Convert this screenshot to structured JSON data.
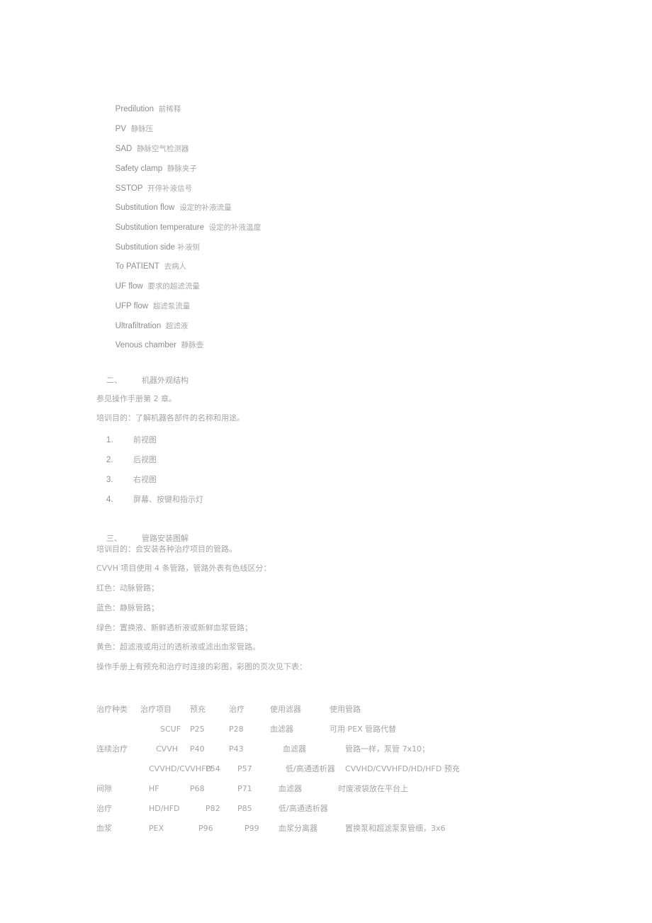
{
  "document": {
    "language": "zh-CN + en",
    "text_color": "#a0a0a0",
    "background": "#ffffff"
  },
  "glossary": {
    "items": [
      {
        "term": "Predilution",
        "gloss": "前稀释"
      },
      {
        "term": "PV",
        "gloss": "静脉压"
      },
      {
        "term": "SAD",
        "gloss": "静脉空气检测器"
      },
      {
        "term": "Safety clamp",
        "gloss": "静脉夹子"
      },
      {
        "term": "SSTOP",
        "gloss": "开停补液信号"
      },
      {
        "term": "Substitution flow",
        "gloss": "设定的补液流量"
      },
      {
        "term": "Substitution temperature",
        "gloss": "设定的补液温度"
      },
      {
        "term": "Substitution side",
        "gloss": "补液侧"
      },
      {
        "term": "To PATIENT",
        "gloss": "去病人"
      },
      {
        "term": "UF flow",
        "gloss": "要求的超滤流量"
      },
      {
        "term": "UFP flow",
        "gloss": "超滤泵流量"
      },
      {
        "term": "Ultrafiltration",
        "gloss": "超滤液"
      },
      {
        "term": "Venous chamber",
        "gloss": "静脉壶"
      }
    ]
  },
  "section_two": {
    "number": "二、",
    "title": "机器外观结构",
    "reference": "参见操作手册第 2 章。",
    "objective": "培训目的：了解机器各部件的名称和用途。",
    "items": [
      {
        "index": "1.",
        "label": "前视图"
      },
      {
        "index": "2.",
        "label": "后视图"
      },
      {
        "index": "3.",
        "label": "右视图"
      },
      {
        "index": "4.",
        "label": "屏幕、按键和指示灯"
      }
    ]
  },
  "section_three": {
    "number": "三、",
    "title": "管路安装图解",
    "objective": "培训目的：会安装各种治疗项目的管路。",
    "intro": "CVVH 项目使用 4 条管路，管路外表有色线区分：",
    "color_codes": [
      "红色：动脉管路；",
      "蓝色：静脉管路；",
      "绿色：置换液、新鲜透析液或新鲜血浆管路；",
      "黄色：超滤液或用过的透析液或滤出血浆管路。"
    ],
    "table_intro": "操作手册上有预充和治疗时连接的彩图，彩图的页次见下表："
  },
  "table": {
    "headers": [
      "治疗种类",
      "治疗项目",
      "预充",
      "治疗",
      "使用滤器",
      "使用管路"
    ],
    "rows": [
      {
        "indent": "ind-1",
        "cells": [
          "",
          "SCUF",
          "P25",
          "P28",
          "血滤器",
          "可用 PEX 管路代替"
        ]
      },
      {
        "indent": "",
        "cells": [
          "连续治疗",
          "CVVH",
          "P40",
          "P43",
          "血滤器",
          "管路一样，泵管 7x10；"
        ]
      },
      {
        "indent": "ind-2",
        "cells": [
          "",
          "CVVHD/CVVHFD",
          "P54",
          "P57",
          "低/高通透析器",
          "CVVHD/CVVHFD/HD/HFD 预充"
        ]
      },
      {
        "indent": "",
        "cells": [
          "间隙",
          "HF",
          "P68",
          "P71",
          "血滤器",
          "时废液袋放在平台上"
        ]
      },
      {
        "indent": "",
        "cells": [
          "治疗",
          "HD/HFD",
          "P82",
          "P85",
          "低/高通透析器",
          ""
        ]
      },
      {
        "indent": "",
        "cells": [
          "血浆",
          "PEX",
          "P96",
          "P99",
          "血浆分离器",
          "置换泵和超滤泵泵管细，3x6"
        ]
      }
    ]
  }
}
